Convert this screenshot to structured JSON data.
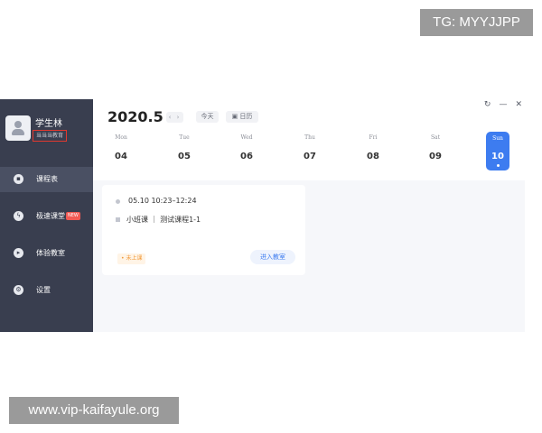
{
  "watermarks": {
    "top": "TG: MYYJJPP",
    "bottom": "www.vip-kaifayule.org"
  },
  "sidebar": {
    "user_name": "学生林",
    "org_name": "当当当教育",
    "items": [
      {
        "label": "课程表",
        "icon": "calendar-icon",
        "active": true
      },
      {
        "label": "极速课堂",
        "icon": "lightning-icon",
        "badge": "NEW"
      },
      {
        "label": "体验教室",
        "icon": "play-icon"
      },
      {
        "label": "设置",
        "icon": "gear-icon"
      }
    ]
  },
  "window_controls": {
    "refresh": "↻",
    "minimize": "—",
    "close": "✕"
  },
  "header": {
    "month_title": "2020.5",
    "nav_arrows": "‹ ›",
    "today_label": "今天",
    "calendar_label": "日历"
  },
  "week": [
    {
      "name": "Mon",
      "date": "04"
    },
    {
      "name": "Tue",
      "date": "05"
    },
    {
      "name": "Wed",
      "date": "06"
    },
    {
      "name": "Thu",
      "date": "07"
    },
    {
      "name": "Fri",
      "date": "08"
    },
    {
      "name": "Sat",
      "date": "09"
    },
    {
      "name": "Sun",
      "date": "10",
      "selected": true
    }
  ],
  "lesson": {
    "time": "05.10  10:23–12:24",
    "title": "小班课 ｜ 测试课程1-1",
    "status": "• 未上课",
    "enter_label": "进入教室"
  },
  "colors": {
    "sidebar": "#393e4f",
    "accent": "#3d7cf0",
    "badge": "#f25a54",
    "org_border": "#e1392f",
    "status": "#f29a3a"
  }
}
